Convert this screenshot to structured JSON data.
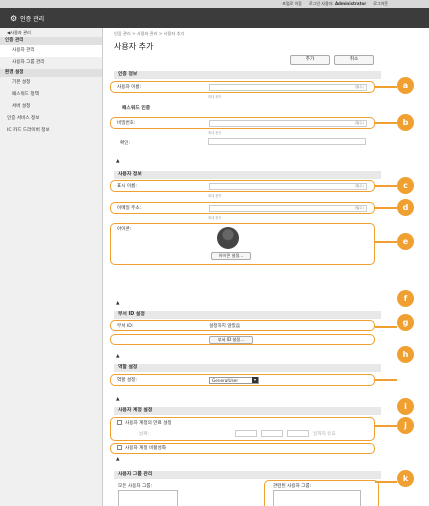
{
  "topbar": {
    "portal": "포털로 이동",
    "login_user_label": "로그인 사용자:",
    "login_user": "Administrator",
    "logout": "로그아웃"
  },
  "header": {
    "title": "인증 관리"
  },
  "sidebar": {
    "back": "◀사용자 관리",
    "sections": [
      {
        "title": "인증 관리",
        "items": [
          "사용자 관리",
          "사용자 그룹 관리"
        ]
      },
      {
        "title": "환경 설정",
        "items": [
          "기본 설정",
          "패스워드 정책",
          "서버 설정"
        ]
      }
    ],
    "extra": [
      "인증 서비스 정보",
      "IC 카드 드라이버 정보"
    ]
  },
  "main": {
    "breadcrumb": "인증 관리 > 사용자 관리 > 사용자 추가",
    "title": "사용자 추가",
    "add_btn": "추가",
    "cancel_btn": "취소",
    "login_section": "인증 정보",
    "username_label": "사용자 이름:",
    "required": "(필수)",
    "size_hint": "최대 문자",
    "password_section": "패스워드 인증",
    "password_label": "비밀번호:",
    "confirm_label": "확인:",
    "user_info_section": "사용자 정보",
    "display_name_label": "표시 이름:",
    "email_label": "이메일 주소:",
    "icon_label": "아이콘:",
    "icon_btn": "아이콘 설정...",
    "dept_section": "부서 ID 설정",
    "dept_label": "부서 ID:",
    "dept_value": "설정하지 않았음",
    "dept_btn": "부서 ID 설정...",
    "role_section": "역할 설정",
    "role_label": "역할 설정:",
    "role_value": "GeneralUser",
    "account_section": "사용자 계정 설정",
    "expiry_label": "사용자 계정의 만료 설정",
    "date_label": "날짜:",
    "date_suffix": "일까지 유효",
    "disable_label": "사용자 계정 비활성화",
    "group_section": "사용자 그룹 관리",
    "all_groups": "모든 사용자 그룹:",
    "assigned_groups": "관련된 사용자 그룹:"
  },
  "badges": [
    "a",
    "b",
    "c",
    "d",
    "e",
    "f",
    "g",
    "h",
    "i",
    "j",
    "k"
  ],
  "accent": "#f0a030"
}
